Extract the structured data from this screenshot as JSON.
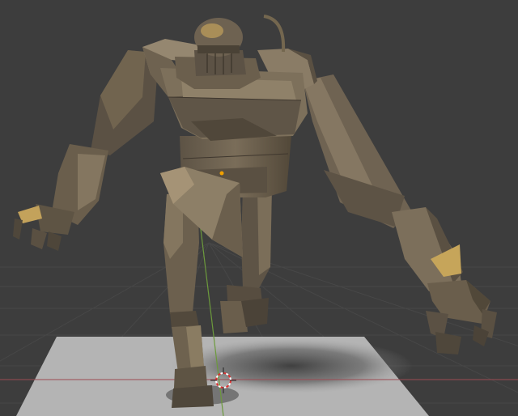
{
  "app": {
    "editor": "3D Viewport",
    "shading_mode": "rendered"
  },
  "scene": {
    "object": "robot-model",
    "ground": "shadow-catcher-plane",
    "grid": true,
    "axes": [
      "x-axis",
      "y-axis"
    ],
    "cursor": "3d-cursor",
    "origin_marker": true
  },
  "colors": {
    "background": "#3d3d3d",
    "grid_line": "#474747",
    "x_axis": "#9c4a52",
    "y_axis": "#6c9a3c",
    "metal_base": "#6f6352",
    "metal_light": "#8f8068",
    "metal_dark": "#3f372e",
    "metal_highlight": "#c6a55a",
    "ground_plane": "#b4b4b4",
    "shadow": "#4a4a4a",
    "origin_dot": "#f0a000"
  }
}
